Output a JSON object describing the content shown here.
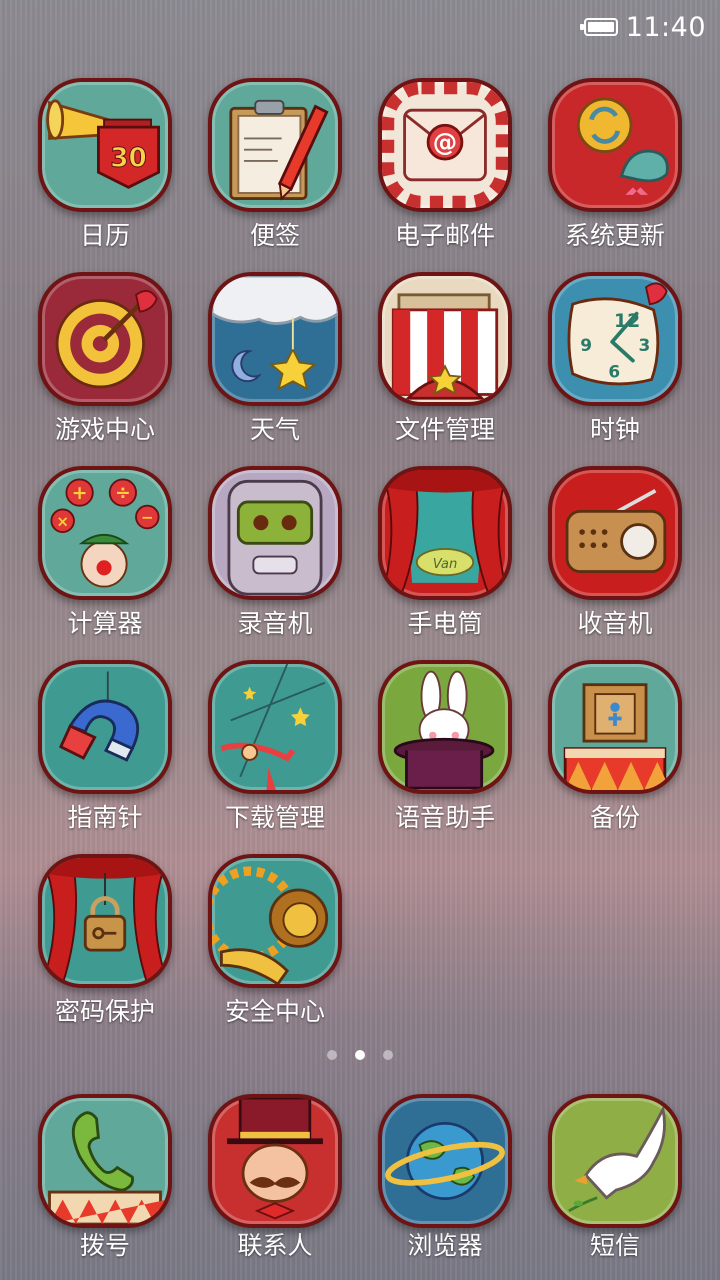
{
  "status_bar": {
    "time": "11:40",
    "battery_icon": "battery-icon"
  },
  "apps": [
    {
      "name": "calendar",
      "label": "日历",
      "bg": "#5fa89a",
      "icon": "calendar-icon",
      "day": "30"
    },
    {
      "name": "notes",
      "label": "便签",
      "bg": "#5fa89a",
      "icon": "notes-icon"
    },
    {
      "name": "email",
      "label": "电子邮件",
      "bg": "#f2e6d8",
      "icon": "email-icon"
    },
    {
      "name": "system-update",
      "label": "系统更新",
      "bg": "#c8282a",
      "icon": "update-icon"
    },
    {
      "name": "game-center",
      "label": "游戏中心",
      "bg": "#9a2a3a",
      "icon": "target-icon"
    },
    {
      "name": "weather",
      "label": "天气",
      "bg": "#2f6f96",
      "icon": "weather-icon"
    },
    {
      "name": "file-manager",
      "label": "文件管理",
      "bg": "#e8d9c0",
      "icon": "folder-icon"
    },
    {
      "name": "clock",
      "label": "时钟",
      "bg": "#3d8fb0",
      "icon": "clock-icon"
    },
    {
      "name": "calculator",
      "label": "计算器",
      "bg": "#5fa89a",
      "icon": "calculator-icon"
    },
    {
      "name": "recorder",
      "label": "录音机",
      "bg": "#b7a7c0",
      "icon": "recorder-icon"
    },
    {
      "name": "flashlight",
      "label": "手电筒",
      "bg": "#c81e1e",
      "icon": "flashlight-icon",
      "text": "Van"
    },
    {
      "name": "radio",
      "label": "收音机",
      "bg": "#c81e1e",
      "icon": "radio-icon"
    },
    {
      "name": "compass",
      "label": "指南针",
      "bg": "#3f9a92",
      "icon": "compass-icon"
    },
    {
      "name": "download-manager",
      "label": "下载管理",
      "bg": "#3f9a92",
      "icon": "download-icon"
    },
    {
      "name": "voice-assistant",
      "label": "语音助手",
      "bg": "#7aa83e",
      "icon": "rabbit-hat-icon"
    },
    {
      "name": "backup",
      "label": "备份",
      "bg": "#5fa89a",
      "icon": "backup-icon"
    },
    {
      "name": "password-protect",
      "label": "密码保护",
      "bg": "#3f9a92",
      "icon": "lock-icon"
    },
    {
      "name": "security-center",
      "label": "安全中心",
      "bg": "#3f9a92",
      "icon": "lion-icon"
    }
  ],
  "page_indicator": {
    "count": 3,
    "active": 1
  },
  "dock": [
    {
      "name": "dialer",
      "label": "拨号",
      "bg": "#5fa89a",
      "icon": "phone-icon"
    },
    {
      "name": "contacts",
      "label": "联系人",
      "bg": "#c83030",
      "icon": "ringmaster-icon"
    },
    {
      "name": "browser",
      "label": "浏览器",
      "bg": "#2f6f96",
      "icon": "globe-icon"
    },
    {
      "name": "messages",
      "label": "短信",
      "bg": "#8fae45",
      "icon": "dove-icon"
    }
  ]
}
